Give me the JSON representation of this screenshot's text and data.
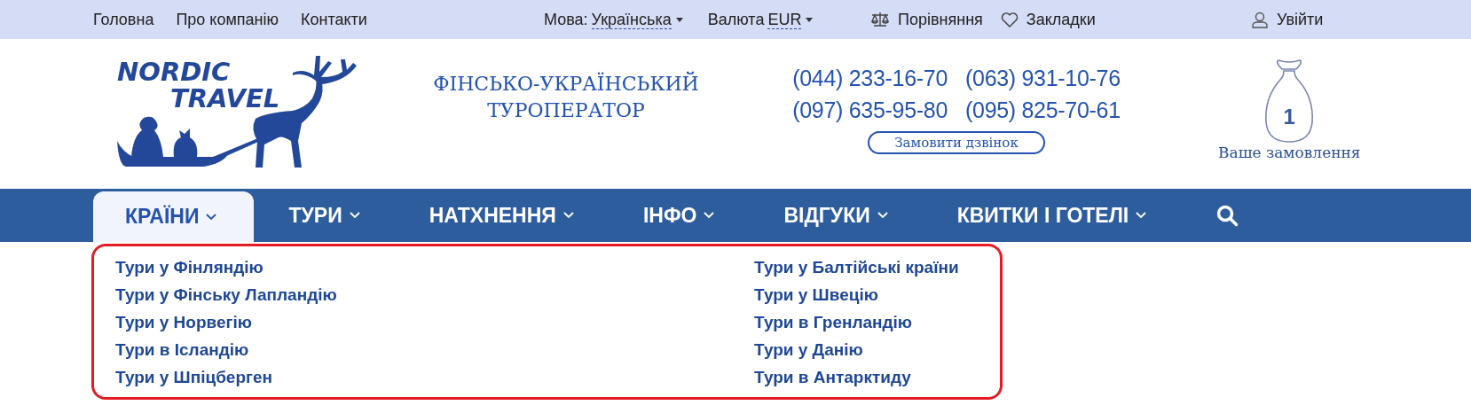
{
  "top_bar": {
    "links": [
      "Головна",
      "Про компанію",
      "Контакти"
    ],
    "language": {
      "label": "Мова:",
      "value": "Українська"
    },
    "currency": {
      "label": "Валюта",
      "value": "EUR"
    },
    "compare": "Порівняння",
    "bookmarks": "Закладки",
    "login": "Увійти"
  },
  "header": {
    "logo": {
      "line_1": "NORDIC",
      "line_2": "TRAVEL"
    },
    "tagline": [
      "ФІНСЬКО-УКРАЇНСЬКИЙ",
      "ТУРОПЕРАТОР"
    ],
    "phones": [
      "(044) 233-16-70",
      "(063) 931-10-76",
      "(097) 635-95-80",
      "(095) 825-70-61"
    ],
    "callback_button": "Замовити дзвінок",
    "cart": {
      "count": "1",
      "label": "Ваше замовлення"
    }
  },
  "nav": {
    "items": [
      {
        "label": "КРАЇНИ",
        "selected": true
      },
      {
        "label": "ТУРИ",
        "selected": false
      },
      {
        "label": "НАТХНЕННЯ",
        "selected": false
      },
      {
        "label": "ІНФО",
        "selected": false
      },
      {
        "label": "ВІДГУКИ",
        "selected": false
      },
      {
        "label": "КВИТКИ І ГОТЕЛІ",
        "selected": false
      }
    ]
  },
  "dropdown": {
    "columns": [
      [
        "Тури у Фінляндію",
        "Тури у Фінську Лапландію",
        "Тури у Норвегію",
        "Тури в Ісландію",
        "Тури у Шпіцберген"
      ],
      [
        "Тури у Балтійські країни",
        "Тури у Швецію",
        "Тури в Гренландію",
        "Тури у Данію",
        "Тури в Антарктиду"
      ]
    ]
  }
}
